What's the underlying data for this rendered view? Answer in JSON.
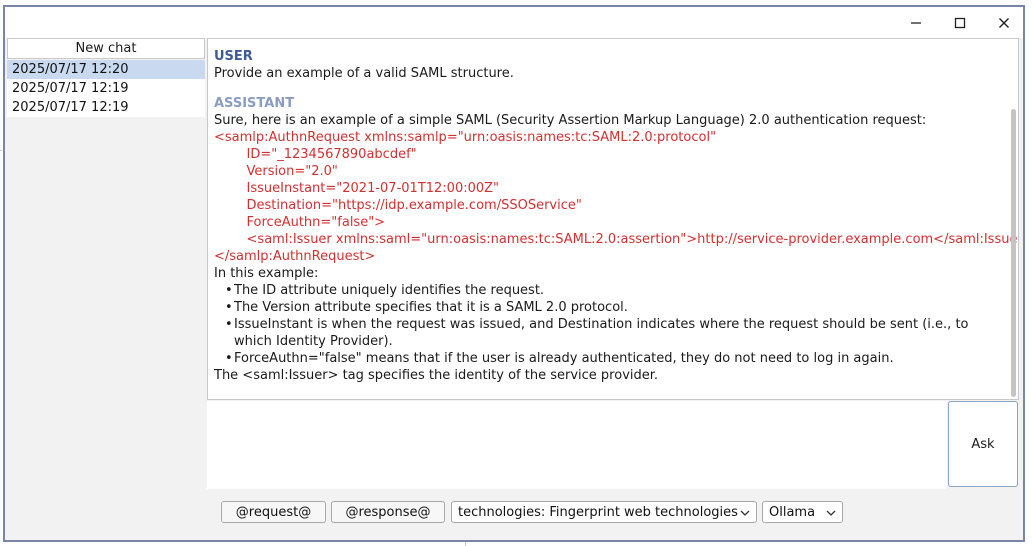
{
  "window": {
    "controls": {
      "minimize": "minimize-icon",
      "maximize": "maximize-icon",
      "close": "close-icon"
    }
  },
  "sidebar": {
    "new_chat_label": "New chat",
    "chats": [
      {
        "label": "2025/07/17 12:20",
        "selected": true
      },
      {
        "label": "2025/07/17 12:19",
        "selected": false
      },
      {
        "label": "2025/07/17 12:19",
        "selected": false
      }
    ]
  },
  "conversation": {
    "user": {
      "role": "USER",
      "text": "Provide an example of a valid SAML structure."
    },
    "assistant": {
      "role": "ASSISTANT",
      "intro": "Sure, here is an example of a simple SAML (Security Assertion Markup Language) 2.0 authentication request:",
      "code_lines": [
        "<samlp:AuthnRequest xmlns:samlp=\"urn:oasis:names:tc:SAML:2.0:protocol\"",
        "    ID=\"_1234567890abcdef\"",
        "    Version=\"2.0\"",
        "    IssueInstant=\"2021-07-01T12:00:00Z\"",
        "    Destination=\"https://idp.example.com/SSOService\"",
        "    ForceAuthn=\"false\">",
        "    <saml:Issuer xmlns:saml=\"urn:oasis:names:tc:SAML:2.0:assertion\">http://service-provider.example.com</saml:Issuer>",
        "</samlp:AuthnRequest>"
      ],
      "example_intro": "In this example:",
      "bullets": [
        "The ID attribute uniquely identifies the request.",
        "The Version attribute specifies that it is a SAML 2.0 protocol.",
        "IssueInstant is when the request was issued, and Destination indicates where the request should be sent (i.e., to which Identity Provider).",
        "ForceAuthn=\"false\" means that if the user is already authenticated, they do not need to log in again."
      ],
      "closing": "The <saml:Issuer> tag specifies the identity of the service provider."
    }
  },
  "input": {
    "value": "",
    "ask_label": "Ask"
  },
  "toolbar": {
    "request_label": "@request@",
    "response_label": "@response@",
    "technologies_selected": "technologies: Fingerprint web technologies",
    "model_selected": "Ollama"
  },
  "colors": {
    "user_role": "#3d5a96",
    "assistant_role": "#8a9cc2",
    "code": "#d23030",
    "selection": "#c9daf0",
    "window_border": "#7a84a6"
  }
}
